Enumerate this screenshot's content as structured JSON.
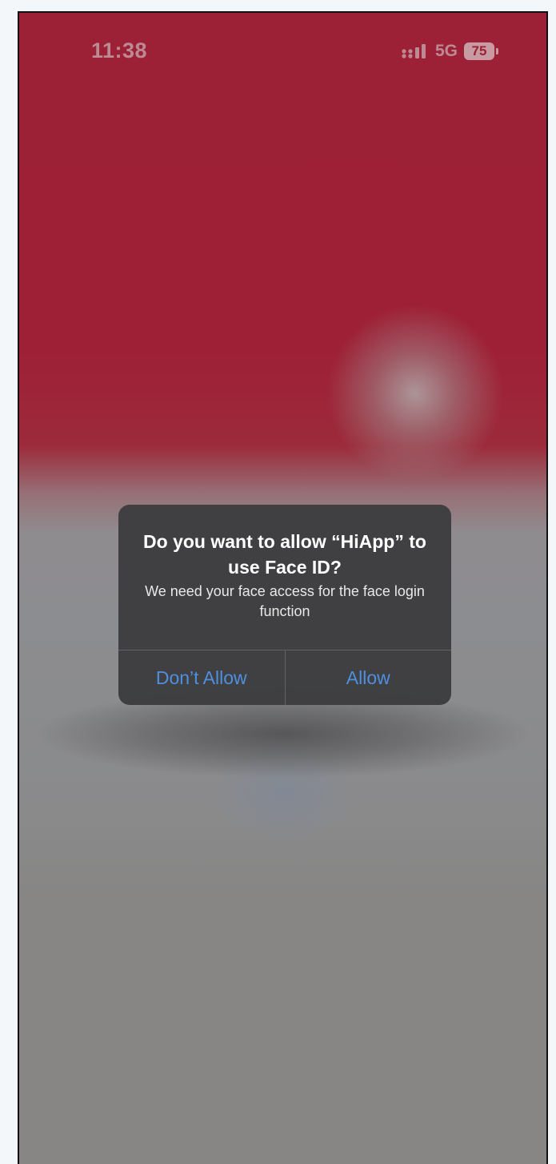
{
  "status_bar": {
    "time": "11:38",
    "network": "5G",
    "battery": "75",
    "signal_icon": "cellular-signal-icon",
    "battery_icon": "battery-icon"
  },
  "alert": {
    "title": "Do you want to allow “HiApp” to use Face ID?",
    "message": "We need your face access for the face login function",
    "buttons": [
      {
        "label": "Don’t Allow"
      },
      {
        "label": "Allow"
      }
    ]
  },
  "colors": {
    "background_top": "#9e2036",
    "background_bottom": "#878685",
    "alert_background": "#3c3c3e",
    "button_text": "#4f8fe0",
    "status_text": "#bd8a93"
  }
}
